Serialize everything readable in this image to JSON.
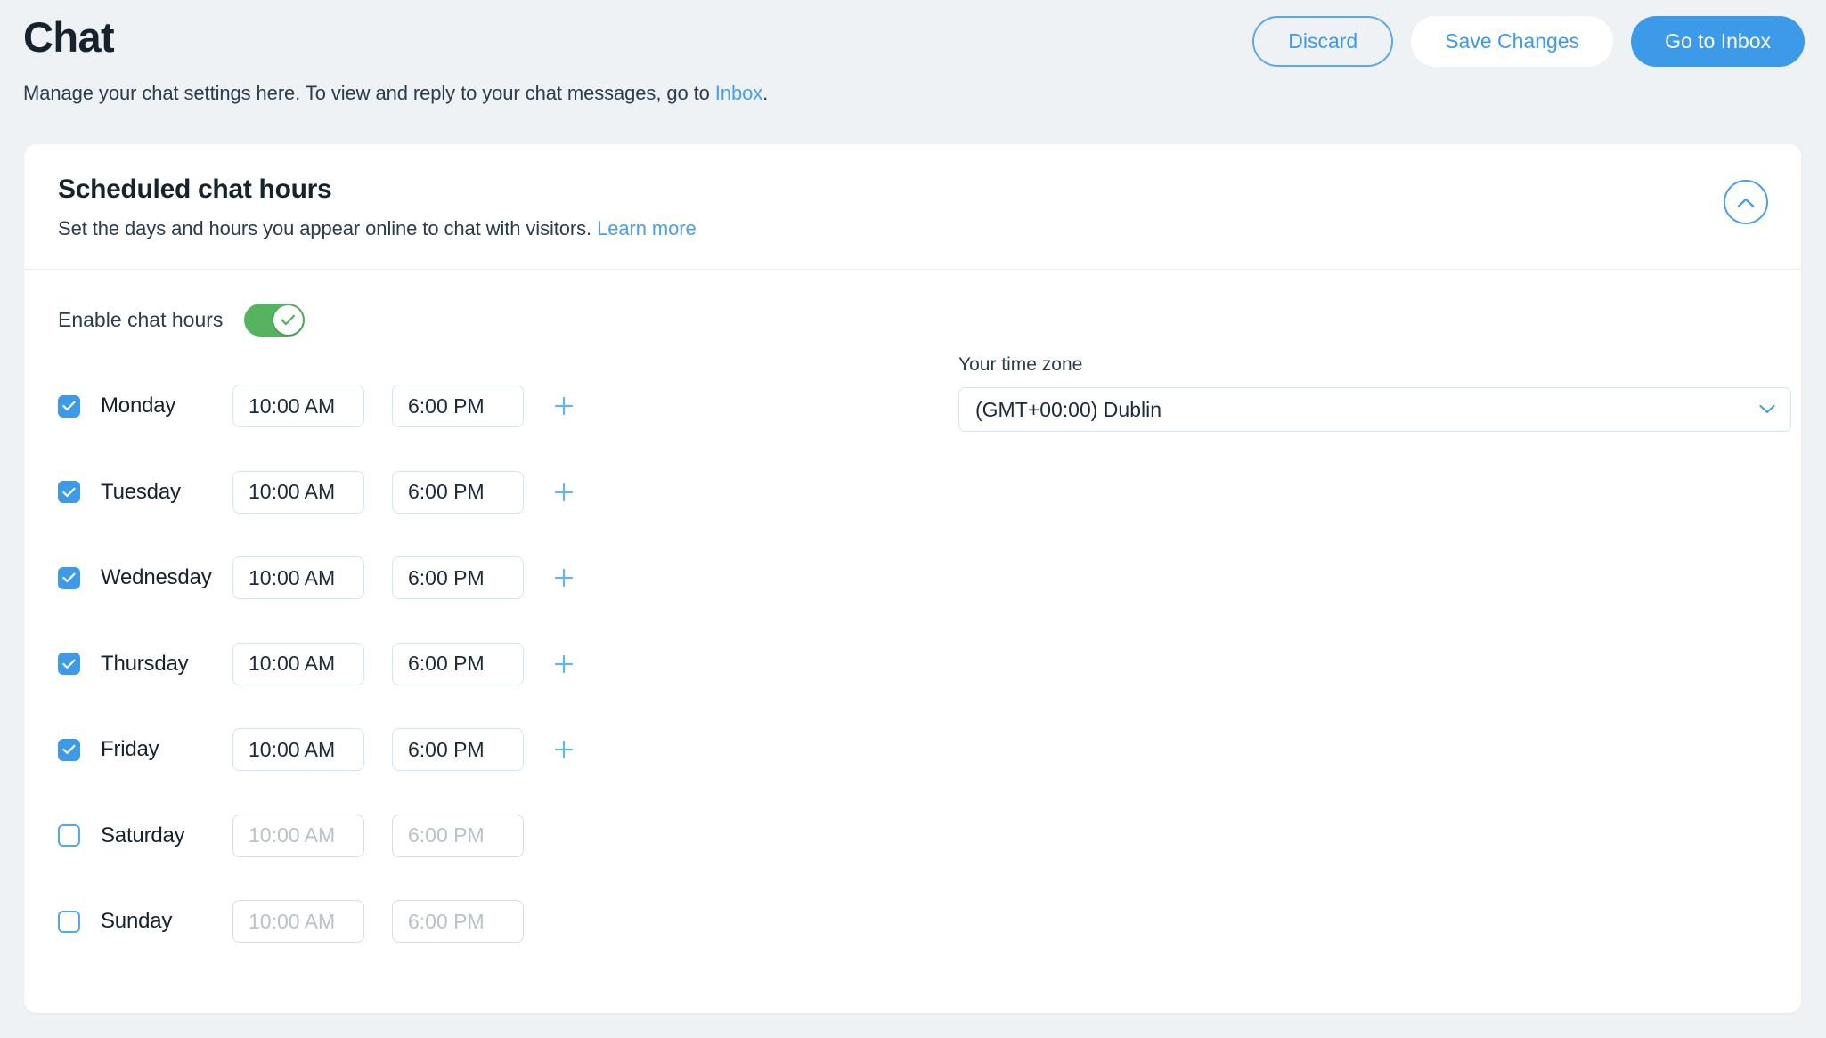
{
  "header": {
    "title": "Chat",
    "subtitle_before": "Manage your chat settings here. To view and reply to your chat messages, go to ",
    "subtitle_link": "Inbox",
    "subtitle_after": ".",
    "buttons": {
      "discard": "Discard",
      "save": "Save Changes",
      "inbox": "Go to Inbox"
    }
  },
  "card": {
    "title": "Scheduled chat hours",
    "subtitle_before": "Set the days and hours you appear online to chat with visitors. ",
    "subtitle_link": "Learn more",
    "collapse_icon": "chevron-up-icon"
  },
  "enable": {
    "label": "Enable chat hours",
    "state": "on"
  },
  "days": [
    {
      "name": "Monday",
      "checked": true,
      "start": "10:00 AM",
      "end": "6:00 PM",
      "add": true
    },
    {
      "name": "Tuesday",
      "checked": true,
      "start": "10:00 AM",
      "end": "6:00 PM",
      "add": true
    },
    {
      "name": "Wednesday",
      "checked": true,
      "start": "10:00 AM",
      "end": "6:00 PM",
      "add": true
    },
    {
      "name": "Thursday",
      "checked": true,
      "start": "10:00 AM",
      "end": "6:00 PM",
      "add": true
    },
    {
      "name": "Friday",
      "checked": true,
      "start": "10:00 AM",
      "end": "6:00 PM",
      "add": true
    },
    {
      "name": "Saturday",
      "checked": false,
      "start": "10:00 AM",
      "end": "6:00 PM",
      "add": false
    },
    {
      "name": "Sunday",
      "checked": false,
      "start": "10:00 AM",
      "end": "6:00 PM",
      "add": false
    }
  ],
  "timezone": {
    "label": "Your time zone",
    "value": "(GMT+00:00) Dublin",
    "chevron_icon": "chevron-down-icon"
  },
  "colors": {
    "page_bg": "#eff2f5",
    "accent_blue": "#3d9ae8",
    "link_blue": "#4a9eea",
    "toggle_green": "#56b461",
    "text_dark": "#16232f",
    "border_light_blue": "#cfe6f8",
    "border_gray": "#d7dde3",
    "placeholder_gray": "#b9c2ca"
  }
}
